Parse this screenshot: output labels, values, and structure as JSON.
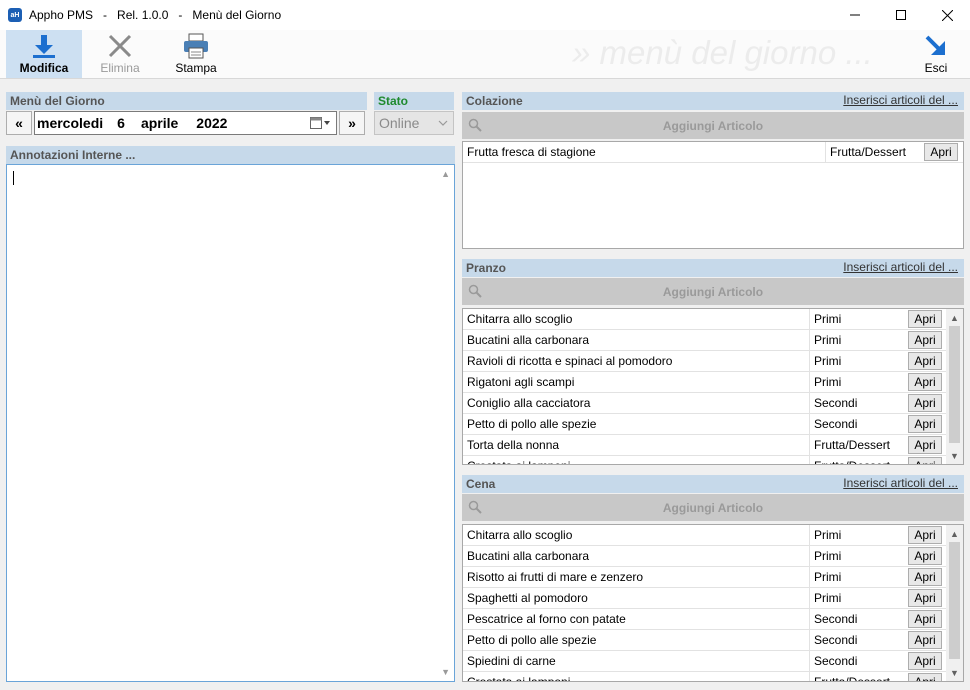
{
  "window": {
    "icon_text": "aH",
    "title": "Appho PMS   -   Rel. 1.0.0   -   Menù del Giorno"
  },
  "toolbar": {
    "modifica": "Modifica",
    "elimina": "Elimina",
    "stampa": "Stampa",
    "esci": "Esci",
    "watermark": "» menù del giorno ..."
  },
  "menu": {
    "header": "Menù del Giorno",
    "prev": "«",
    "next": "»",
    "date": {
      "weekday": "mercoledi",
      "day": "6",
      "month": "aprile",
      "year": "2022"
    }
  },
  "stato": {
    "header": "Stato",
    "value": "Online"
  },
  "notes": {
    "header": "Annotazioni Interne ...",
    "value": ""
  },
  "colazione": {
    "header": "Colazione",
    "link": "Inserisci articoli del ...",
    "search": "Aggiungi Articolo",
    "items": [
      {
        "name": "Frutta fresca di stagione",
        "category": "Frutta/Dessert",
        "action": "Apri"
      }
    ]
  },
  "pranzo": {
    "header": "Pranzo",
    "link": "Inserisci articoli del ...",
    "search": "Aggiungi Articolo",
    "items": [
      {
        "name": "Chitarra allo scoglio",
        "category": "Primi",
        "action": "Apri"
      },
      {
        "name": "Bucatini alla carbonara",
        "category": "Primi",
        "action": "Apri"
      },
      {
        "name": "Ravioli di ricotta e spinaci al pomodoro",
        "category": "Primi",
        "action": "Apri"
      },
      {
        "name": "Rigatoni agli scampi",
        "category": "Primi",
        "action": "Apri"
      },
      {
        "name": "Coniglio alla cacciatora",
        "category": "Secondi",
        "action": "Apri"
      },
      {
        "name": "Petto di pollo alle spezie",
        "category": "Secondi",
        "action": "Apri"
      },
      {
        "name": "Torta della nonna",
        "category": "Frutta/Dessert",
        "action": "Apri"
      },
      {
        "name": "Crostata ai lamponi",
        "category": "Frutta/Dessert",
        "action": "Apri"
      }
    ]
  },
  "cena": {
    "header": "Cena",
    "link": "Inserisci articoli del ...",
    "search": "Aggiungi Articolo",
    "items": [
      {
        "name": "Chitarra allo scoglio",
        "category": "Primi",
        "action": "Apri"
      },
      {
        "name": "Bucatini alla carbonara",
        "category": "Primi",
        "action": "Apri"
      },
      {
        "name": "Risotto ai frutti di mare e zenzero",
        "category": "Primi",
        "action": "Apri"
      },
      {
        "name": "Spaghetti al pomodoro",
        "category": "Primi",
        "action": "Apri"
      },
      {
        "name": "Pescatrice al forno con patate",
        "category": "Secondi",
        "action": "Apri"
      },
      {
        "name": "Petto di pollo alle spezie",
        "category": "Secondi",
        "action": "Apri"
      },
      {
        "name": "Spiedini di carne",
        "category": "Secondi",
        "action": "Apri"
      },
      {
        "name": "Crostata ai lamponi",
        "category": "Frutta/Dessert",
        "action": "Apri"
      }
    ]
  },
  "colors": {
    "header_bg": "#c6d9ea",
    "stato_label": "#1f8a2e",
    "active_button": "#cde0f2",
    "accent_blue": "#1c6fcf"
  },
  "icons": {
    "modifica": "download-arrow-icon",
    "elimina": "scissors-icon",
    "stampa": "printer-icon",
    "esci": "exit-arrow-icon",
    "search": "magnifier-icon",
    "calendar": "calendar-icon"
  }
}
